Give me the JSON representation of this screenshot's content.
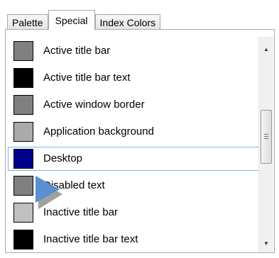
{
  "tabs": [
    {
      "label": "Palette",
      "active": false
    },
    {
      "label": "Special",
      "active": true
    },
    {
      "label": "Index Colors",
      "active": false
    }
  ],
  "color_list": {
    "items": [
      {
        "label": "Active title bar",
        "swatch_color": "#808080"
      },
      {
        "label": "Active title bar text",
        "swatch_color": "#000000"
      },
      {
        "label": "Active window border",
        "swatch_color": "#808080"
      },
      {
        "label": "Application background",
        "swatch_color": "#aaaaaa"
      },
      {
        "label": "Desktop",
        "swatch_color": "#00008b",
        "selected": true
      },
      {
        "label": "Disabled text",
        "swatch_color": "#808080"
      },
      {
        "label": "Inactive title bar",
        "swatch_color": "#c0c0c0"
      },
      {
        "label": "Inactive title bar text",
        "swatch_color": "#000000"
      }
    ],
    "selected_index": 4,
    "selection_border_color": "#7eb4ea"
  },
  "scrollbar": {
    "up_icon": "arrow-up-icon",
    "down_icon": "arrow-down-icon"
  },
  "cursor": {
    "icon": "mouse-pointer-icon",
    "colors": [
      "#5a8fd0",
      "#a0a0a0"
    ]
  }
}
